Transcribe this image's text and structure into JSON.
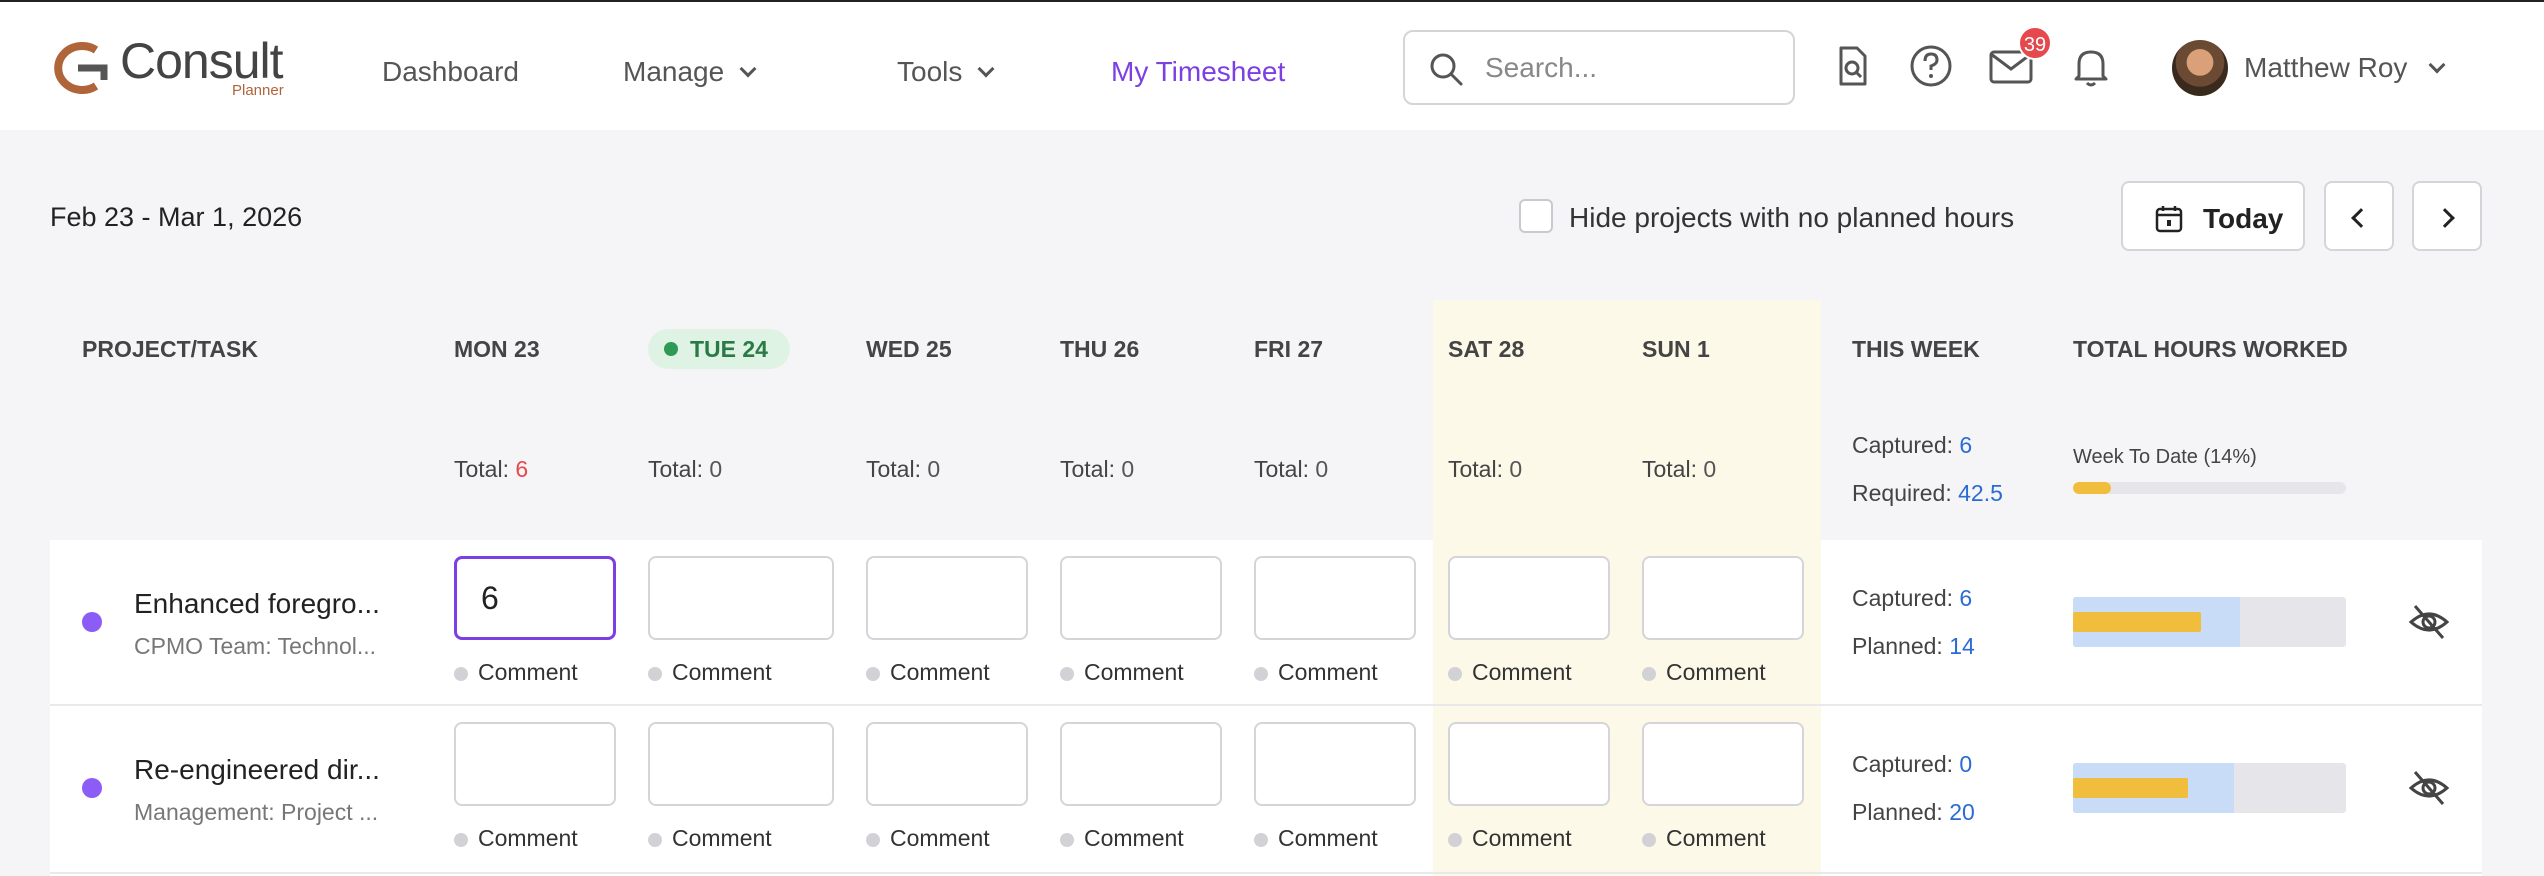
{
  "app": {
    "logo_text": "Consult",
    "logo_sub": "Planner"
  },
  "nav": {
    "dashboard": "Dashboard",
    "manage": "Manage",
    "tools": "Tools",
    "timesheet": "My Timesheet"
  },
  "search": {
    "placeholder": "Search..."
  },
  "notifications": {
    "mail_count": "39"
  },
  "user": {
    "name": "Matthew Roy"
  },
  "toolbar": {
    "date_range": "Feb 23 - Mar 1, 2026",
    "hide_label": "Hide projects with no planned hours",
    "today_label": "Today"
  },
  "table": {
    "headers": {
      "project": "PROJECT/TASK",
      "mon": "MON 23",
      "tue": "TUE 24",
      "wed": "WED 25",
      "thu": "THU 26",
      "fri": "FRI 27",
      "sat": "SAT 28",
      "sun": "SUN 1",
      "this_week": "THIS WEEK",
      "total_hours": "TOTAL HOURS WORKED"
    },
    "total_label": "Total:",
    "totals": {
      "mon": "6",
      "tue": "0",
      "wed": "0",
      "thu": "0",
      "fri": "0",
      "sat": "0",
      "sun": "0"
    },
    "week": {
      "captured_label": "Captured:",
      "captured": "6",
      "required_label": "Required:",
      "required": "42.5",
      "wtd_label": "Week To Date (14%)",
      "wtd_progress": 0.14
    },
    "comment_label": "Comment",
    "captured_label": "Captured:",
    "planned_label": "Planned:",
    "rows": [
      {
        "name": "Enhanced foregro...",
        "sub": "CPMO Team: Technol...",
        "mon_value": "6",
        "captured": "6",
        "planned": "14",
        "planned_fill": 0.61,
        "captured_fill": 0.47
      },
      {
        "name": "Re-engineered dir...",
        "sub": "Management: Project ...",
        "mon_value": "",
        "captured": "0",
        "planned": "20",
        "planned_fill": 0.59,
        "captured_fill": 0.42
      }
    ]
  },
  "colors": {
    "accent": "#7b3fe4",
    "link_blue": "#2a6bd6",
    "badge_red": "#e5484d",
    "weekend": "#fdf9e8",
    "progress_yellow": "#f0bd3c"
  }
}
